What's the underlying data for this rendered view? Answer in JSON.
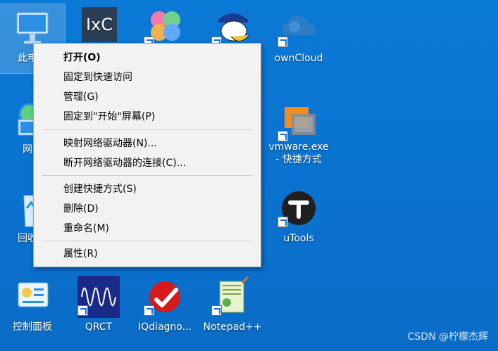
{
  "desktop": {
    "icons": [
      {
        "label": "此电脑"
      },
      {
        "label": "网络"
      },
      {
        "label": "回收站"
      },
      {
        "label": "控制面板"
      },
      {
        "label": "IxC"
      },
      {
        "label": ""
      },
      {
        "label": ""
      },
      {
        "label": "ownCloud"
      },
      {
        "label": "vmware.exe\n- 快捷方式"
      },
      {
        "label": "uTools"
      },
      {
        "label": "QRCT"
      },
      {
        "label": "IQdiagno..."
      },
      {
        "label": "Notepad++"
      }
    ]
  },
  "context_menu": {
    "items": [
      {
        "label": "打开(O)"
      },
      {
        "label": "固定到快速访问"
      },
      {
        "label": "管理(G)"
      },
      {
        "label": "固定到\"开始\"屏幕(P)"
      },
      {
        "label": "映射网络驱动器(N)..."
      },
      {
        "label": "断开网络驱动器的连接(C)..."
      },
      {
        "label": "创建快捷方式(S)"
      },
      {
        "label": "删除(D)"
      },
      {
        "label": "重命名(M)"
      },
      {
        "label": "属性(R)"
      }
    ]
  },
  "watermark": "CSDN @柠檬杰辉",
  "colors": {
    "desktop_bg": "#0b79d6",
    "menu_bg": "#f2f2f2"
  }
}
